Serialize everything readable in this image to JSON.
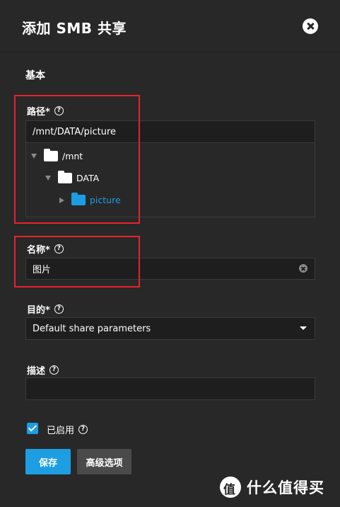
{
  "dialog": {
    "title": "添加 SMB 共享",
    "section": "基本"
  },
  "path": {
    "label": "路径*",
    "value": "/mnt/DATA/picture",
    "tree": [
      {
        "name": "/mnt",
        "expanded": true,
        "highlight": false
      },
      {
        "name": "DATA",
        "expanded": true,
        "highlight": false
      },
      {
        "name": "picture",
        "expanded": false,
        "highlight": true
      }
    ]
  },
  "name_field": {
    "label": "名称*",
    "value": "图片"
  },
  "purpose": {
    "label": "目的*",
    "value": "Default share parameters"
  },
  "description": {
    "label": "描述",
    "value": ""
  },
  "enabled": {
    "label": "已启用",
    "checked": true
  },
  "buttons": {
    "save": "保存",
    "advanced": "高级选项"
  },
  "help_glyph": "?",
  "watermark": {
    "text": "什么值得买"
  },
  "colors": {
    "background": "#282828",
    "input_bg": "#1e1e1e",
    "accent": "#1d9ee3",
    "highlight_box": "#e6222e",
    "secondary_button": "#4a4a4a"
  }
}
